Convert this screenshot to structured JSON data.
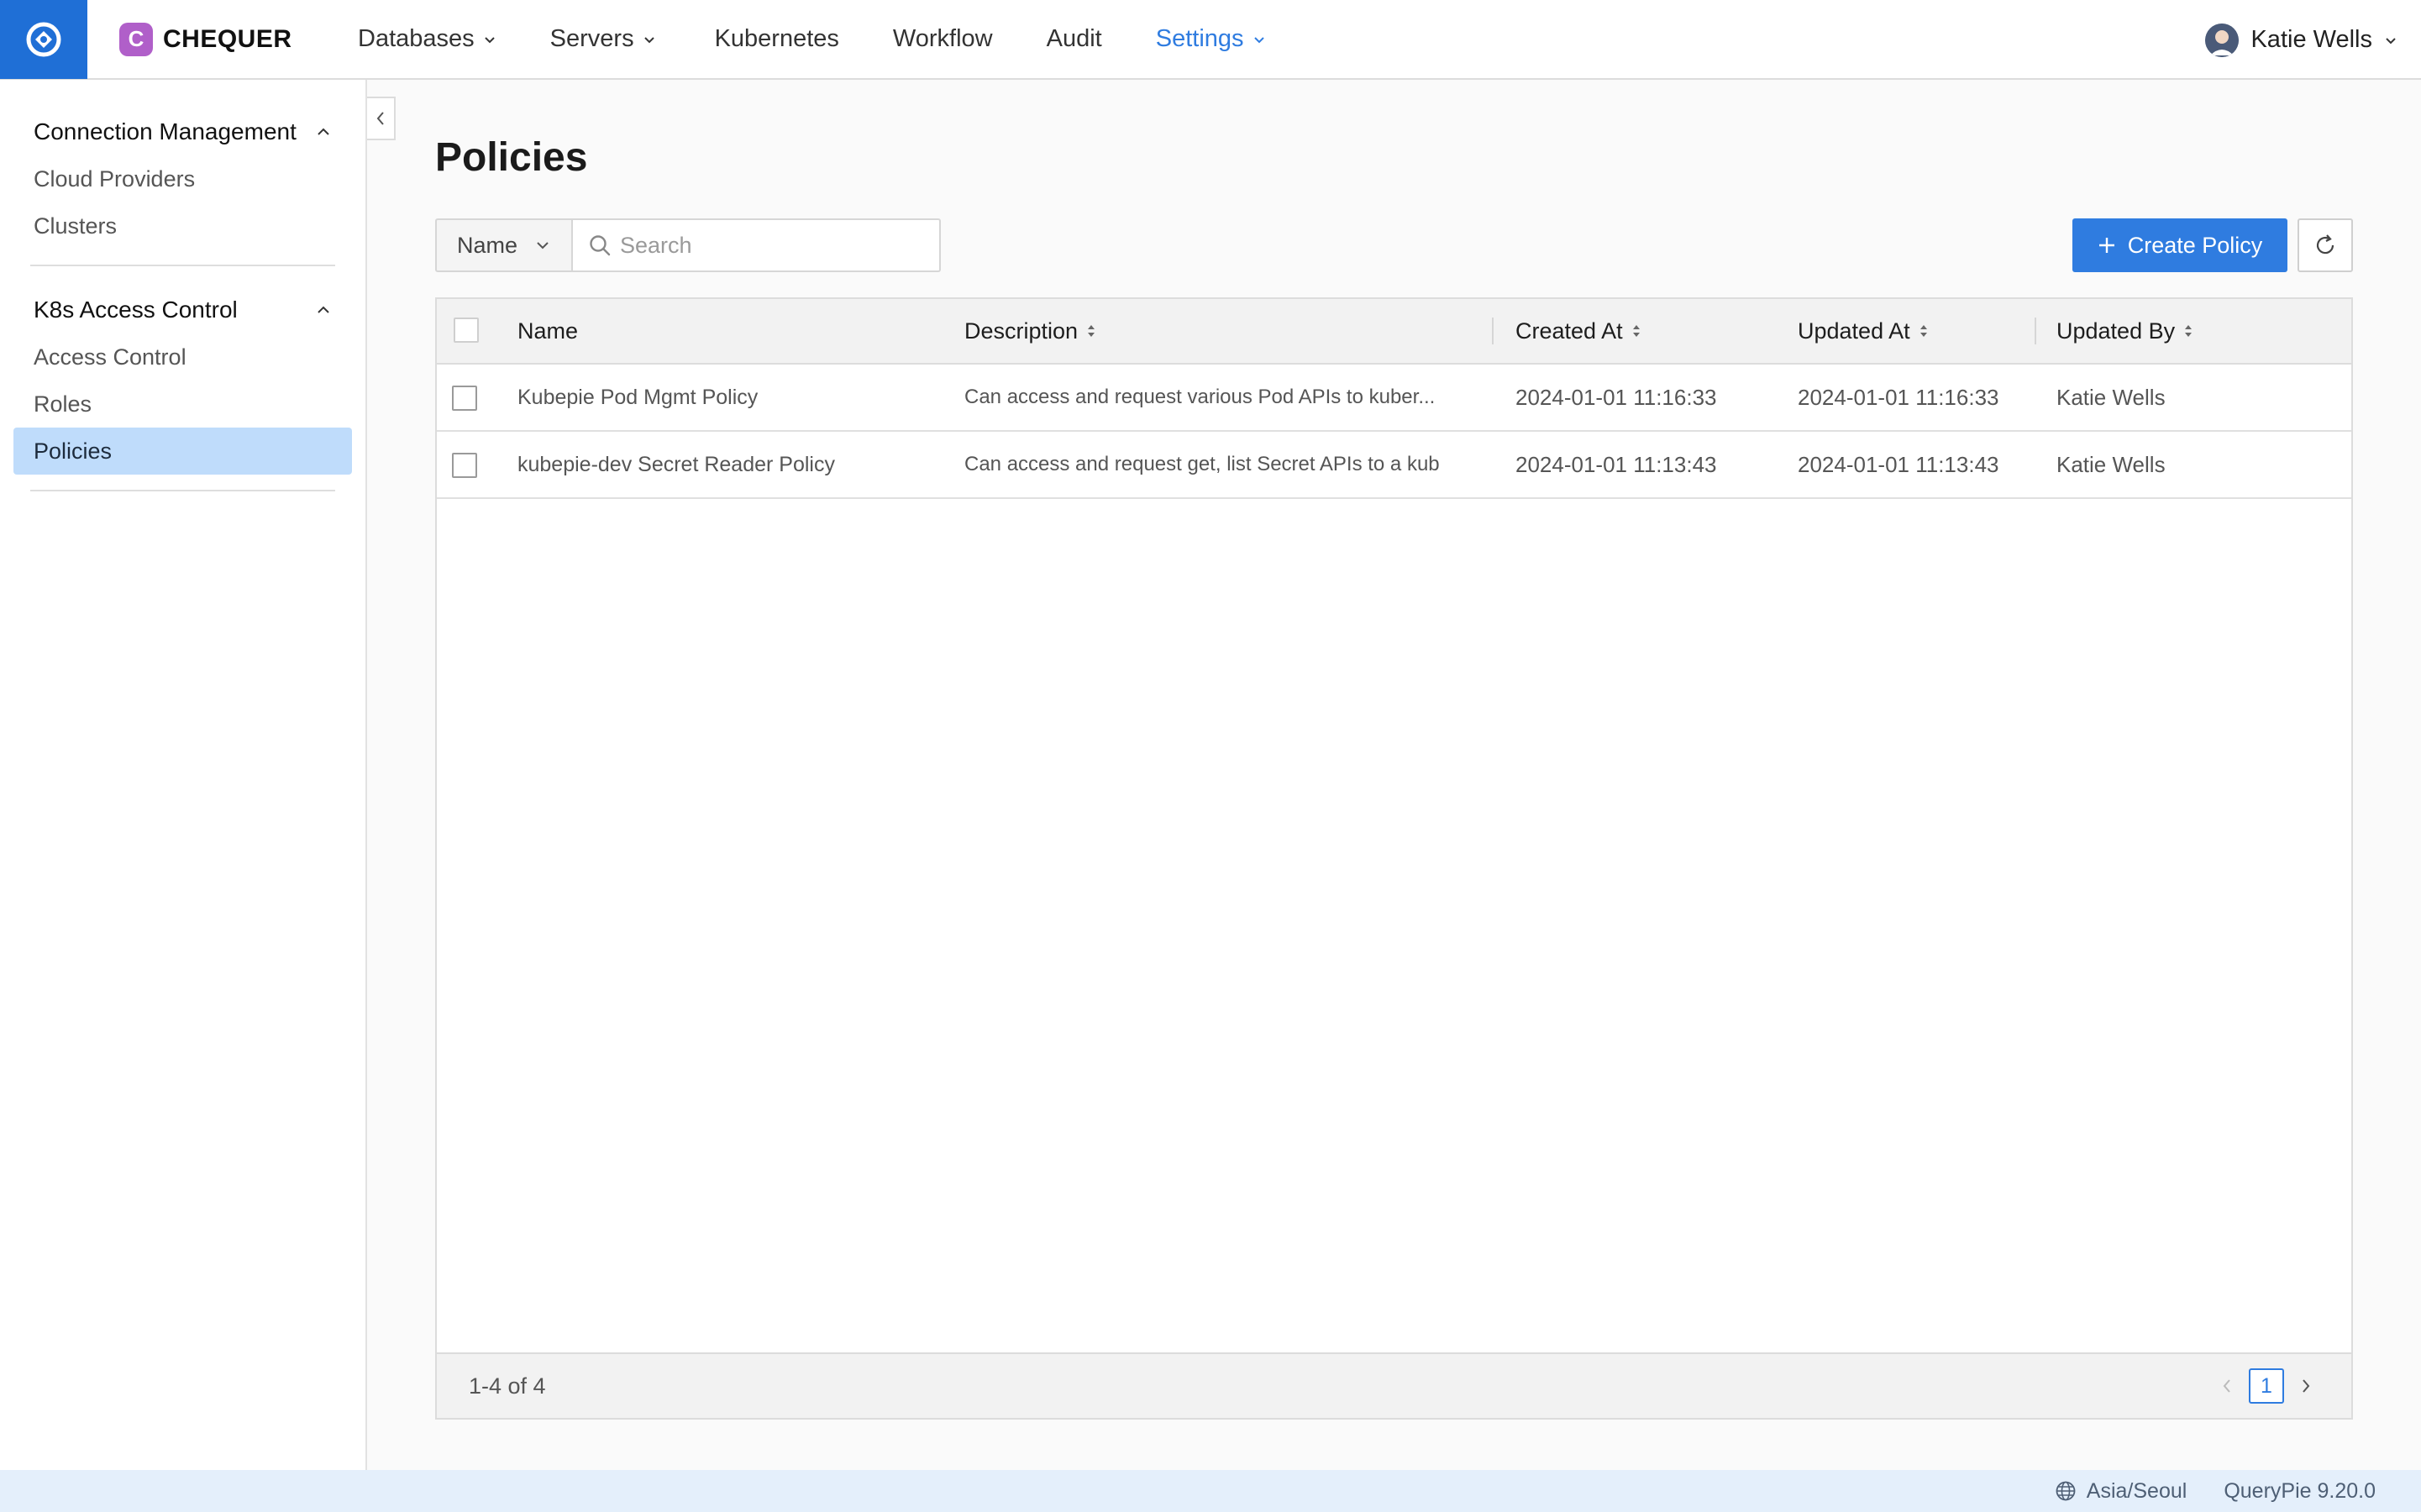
{
  "header": {
    "brand_badge": "C",
    "brand_name": "CHEQUER",
    "nav": [
      {
        "label": "Databases",
        "dropdown": true
      },
      {
        "label": "Servers",
        "dropdown": true
      },
      {
        "label": "Kubernetes",
        "dropdown": false
      },
      {
        "label": "Workflow",
        "dropdown": false
      },
      {
        "label": "Audit",
        "dropdown": false
      },
      {
        "label": "Settings",
        "dropdown": true,
        "active": true
      }
    ],
    "user_name": "Katie Wells"
  },
  "sidebar": {
    "groups": [
      {
        "title": "Connection Management",
        "items": [
          "Cloud Providers",
          "Clusters"
        ]
      },
      {
        "title": "K8s Access Control",
        "items": [
          "Access Control",
          "Roles",
          "Policies"
        ]
      }
    ],
    "active_item": "Policies"
  },
  "main": {
    "title": "Policies",
    "filter_field": "Name",
    "search_placeholder": "Search",
    "create_label": "Create Policy",
    "table": {
      "columns": [
        "Name",
        "Description",
        "Created At",
        "Updated At",
        "Updated By"
      ],
      "rows": [
        {
          "name": "Kubepie Pod Mgmt Policy",
          "description": "Can access and request various Pod APIs to kuber...",
          "created_at": "2024-01-01 11:16:33",
          "updated_at": "2024-01-01 11:16:33",
          "updated_by": "Katie Wells"
        },
        {
          "name": "kubepie-dev Secret Reader Policy",
          "description": "Can access and request get, list Secret APIs to a kub",
          "created_at": "2024-01-01 11:13:43",
          "updated_at": "2024-01-01 11:13:43",
          "updated_by": "Katie Wells"
        }
      ]
    },
    "pagination": {
      "range_text": "1-4 of 4",
      "current_page": "1"
    }
  },
  "status": {
    "timezone": "Asia/Seoul",
    "version": "QueryPie 9.20.0"
  },
  "colors": {
    "primary": "#2f7ce0",
    "logo_bg": "#1f6fd6",
    "brand_badge": "#b05fc9",
    "active_item_bg": "#bfdcfb"
  }
}
